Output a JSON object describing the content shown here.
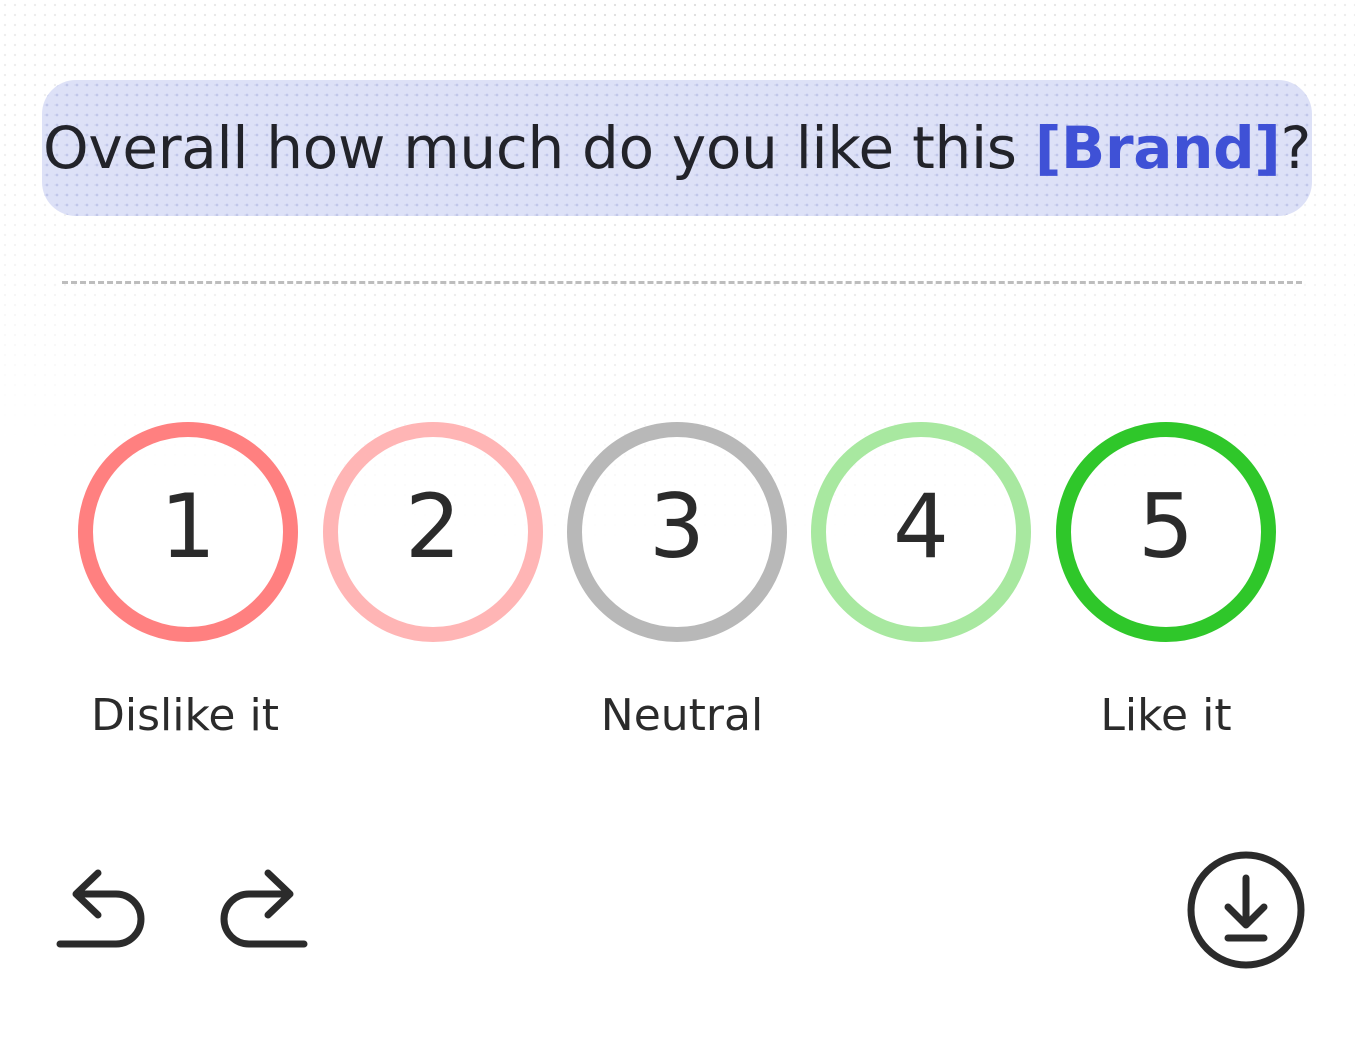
{
  "question": {
    "prefix": "Overall how much do you like this ",
    "brand": "[Brand]",
    "suffix": "?"
  },
  "rating_options": [
    {
      "value": "1",
      "color": "#ff8080"
    },
    {
      "value": "2",
      "color": "#ffb5b5"
    },
    {
      "value": "3",
      "color": "#b8b8b8"
    },
    {
      "value": "4",
      "color": "#a8e8a0"
    },
    {
      "value": "5",
      "color": "#2fc72a"
    }
  ],
  "scale_labels": {
    "low": "Dislike it",
    "mid": "Neutral",
    "high": "Like it"
  },
  "toolbar": {
    "undo_icon": "undo-icon",
    "redo_icon": "redo-icon",
    "download_icon": "download-icon"
  },
  "colors": {
    "accent": "#3f51d6",
    "question_bg": "#d6dbf5",
    "text": "#2b2b2b"
  }
}
